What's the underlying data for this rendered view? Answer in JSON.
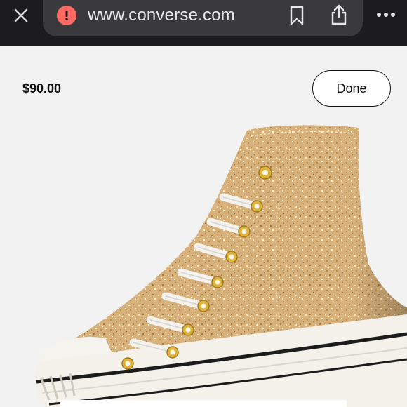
{
  "browser": {
    "url": "www.converse.com",
    "icons": {
      "close": "close-icon",
      "warning": "warning-icon",
      "bookmark": "bookmark-icon",
      "share": "share-icon",
      "more": "more-icon"
    }
  },
  "product": {
    "price": "$90.00",
    "done_label": "Done",
    "image": "gold-glitter-high-top-sneaker"
  },
  "colors": {
    "toolbar": "#1c1c1e",
    "url_bar": "#3a3a3c",
    "warning": "#ff6961",
    "background": "#f2f2f2",
    "glitter": "#d9b27a"
  }
}
